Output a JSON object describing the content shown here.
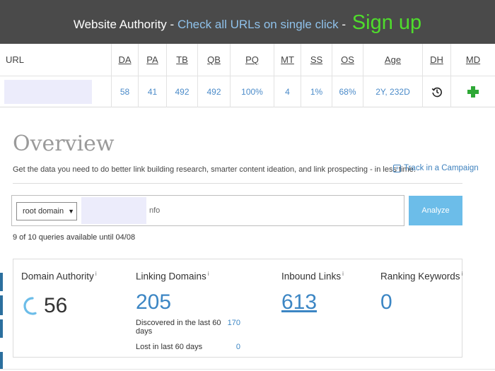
{
  "banner": {
    "title": "Website Authority",
    "separator": "-",
    "link_text": "Check all URLs on single click",
    "signup": "Sign up"
  },
  "metrics": {
    "headers": [
      "URL",
      "DA",
      "PA",
      "TB",
      "QB",
      "PQ",
      "MT",
      "SS",
      "OS",
      "Age",
      "DH",
      "MD"
    ],
    "values": {
      "da": "58",
      "pa": "41",
      "tb": "492",
      "qb": "492",
      "pq": "100%",
      "mt": "4",
      "ss": "1%",
      "os": "68%",
      "age": "2Y, 232D"
    },
    "dh_icon": "history-icon",
    "md_icon": "plus-icon",
    "md_color": "#2ea836"
  },
  "overview": {
    "title": "Overview",
    "description": "Get the data you need to do better link building research, smarter content ideation, and link prospecting - in less time.",
    "track_link": "Track in a Campaign",
    "track_icon": "plus-square-icon"
  },
  "search": {
    "select_value": "root domain",
    "input_value": "nfo",
    "analyze_label": "Analyze",
    "queries_text": "9 of 10 queries available until 04/08"
  },
  "stats": {
    "domain_authority": {
      "label": "Domain Authority",
      "info": "i",
      "value": "56",
      "progress": 0.56
    },
    "linking_domains": {
      "label": "Linking Domains",
      "info": "i",
      "value": "205",
      "discovered_label": "Discovered in the last 60 days",
      "discovered_value": "170",
      "lost_label": "Lost in last 60 days",
      "lost_value": "0"
    },
    "inbound_links": {
      "label": "Inbound Links",
      "info": "i",
      "value": "613"
    },
    "ranking_keywords": {
      "label": "Ranking Keywords",
      "info": "i",
      "value": "0"
    }
  },
  "colors": {
    "banner_bg": "#4a4a4a",
    "link_blue": "#8fc1ea",
    "signup_green": "#4fdc2c",
    "value_blue": "#3c86c4",
    "analyze_bg": "#6cbde9"
  }
}
